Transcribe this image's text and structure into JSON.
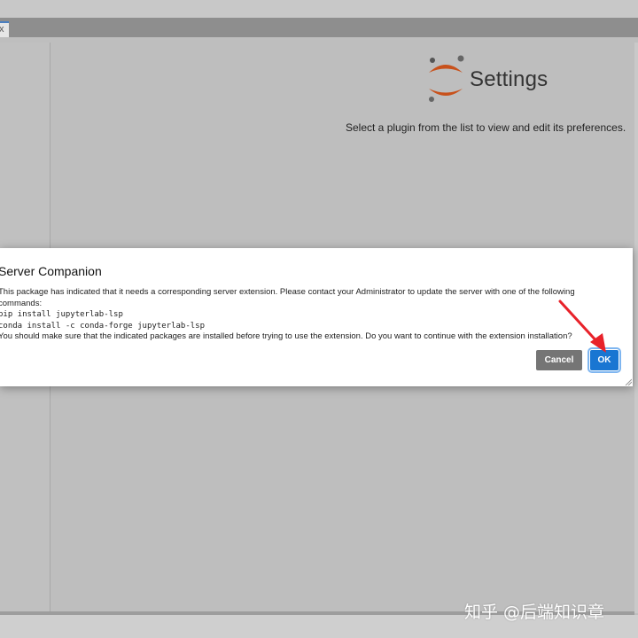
{
  "tab": {
    "label": "x"
  },
  "settings": {
    "title": "Settings",
    "subtitle": "Select a plugin from the list to view and edit its preferences."
  },
  "dialog": {
    "title": "Server Companion",
    "body": {
      "line1": "This package has indicated that it needs a corresponding server extension. Please contact your Administrator to update the server with one of the following",
      "line2": "commands:",
      "cmd1": "pip install jupyterlab-lsp",
      "cmd2": "conda install -c conda-forge jupyterlab-lsp",
      "line3": "You should make sure that the indicated packages are installed before trying to use the extension. Do you want to continue with the extension installation?"
    },
    "cancel_label": "Cancel",
    "ok_label": "OK"
  },
  "watermark": "知乎 @后端知识章",
  "colors": {
    "accent": "#1976d2",
    "cancel": "#757575",
    "logo_orange": "#c8511b",
    "arrow_red": "#e8222a"
  }
}
